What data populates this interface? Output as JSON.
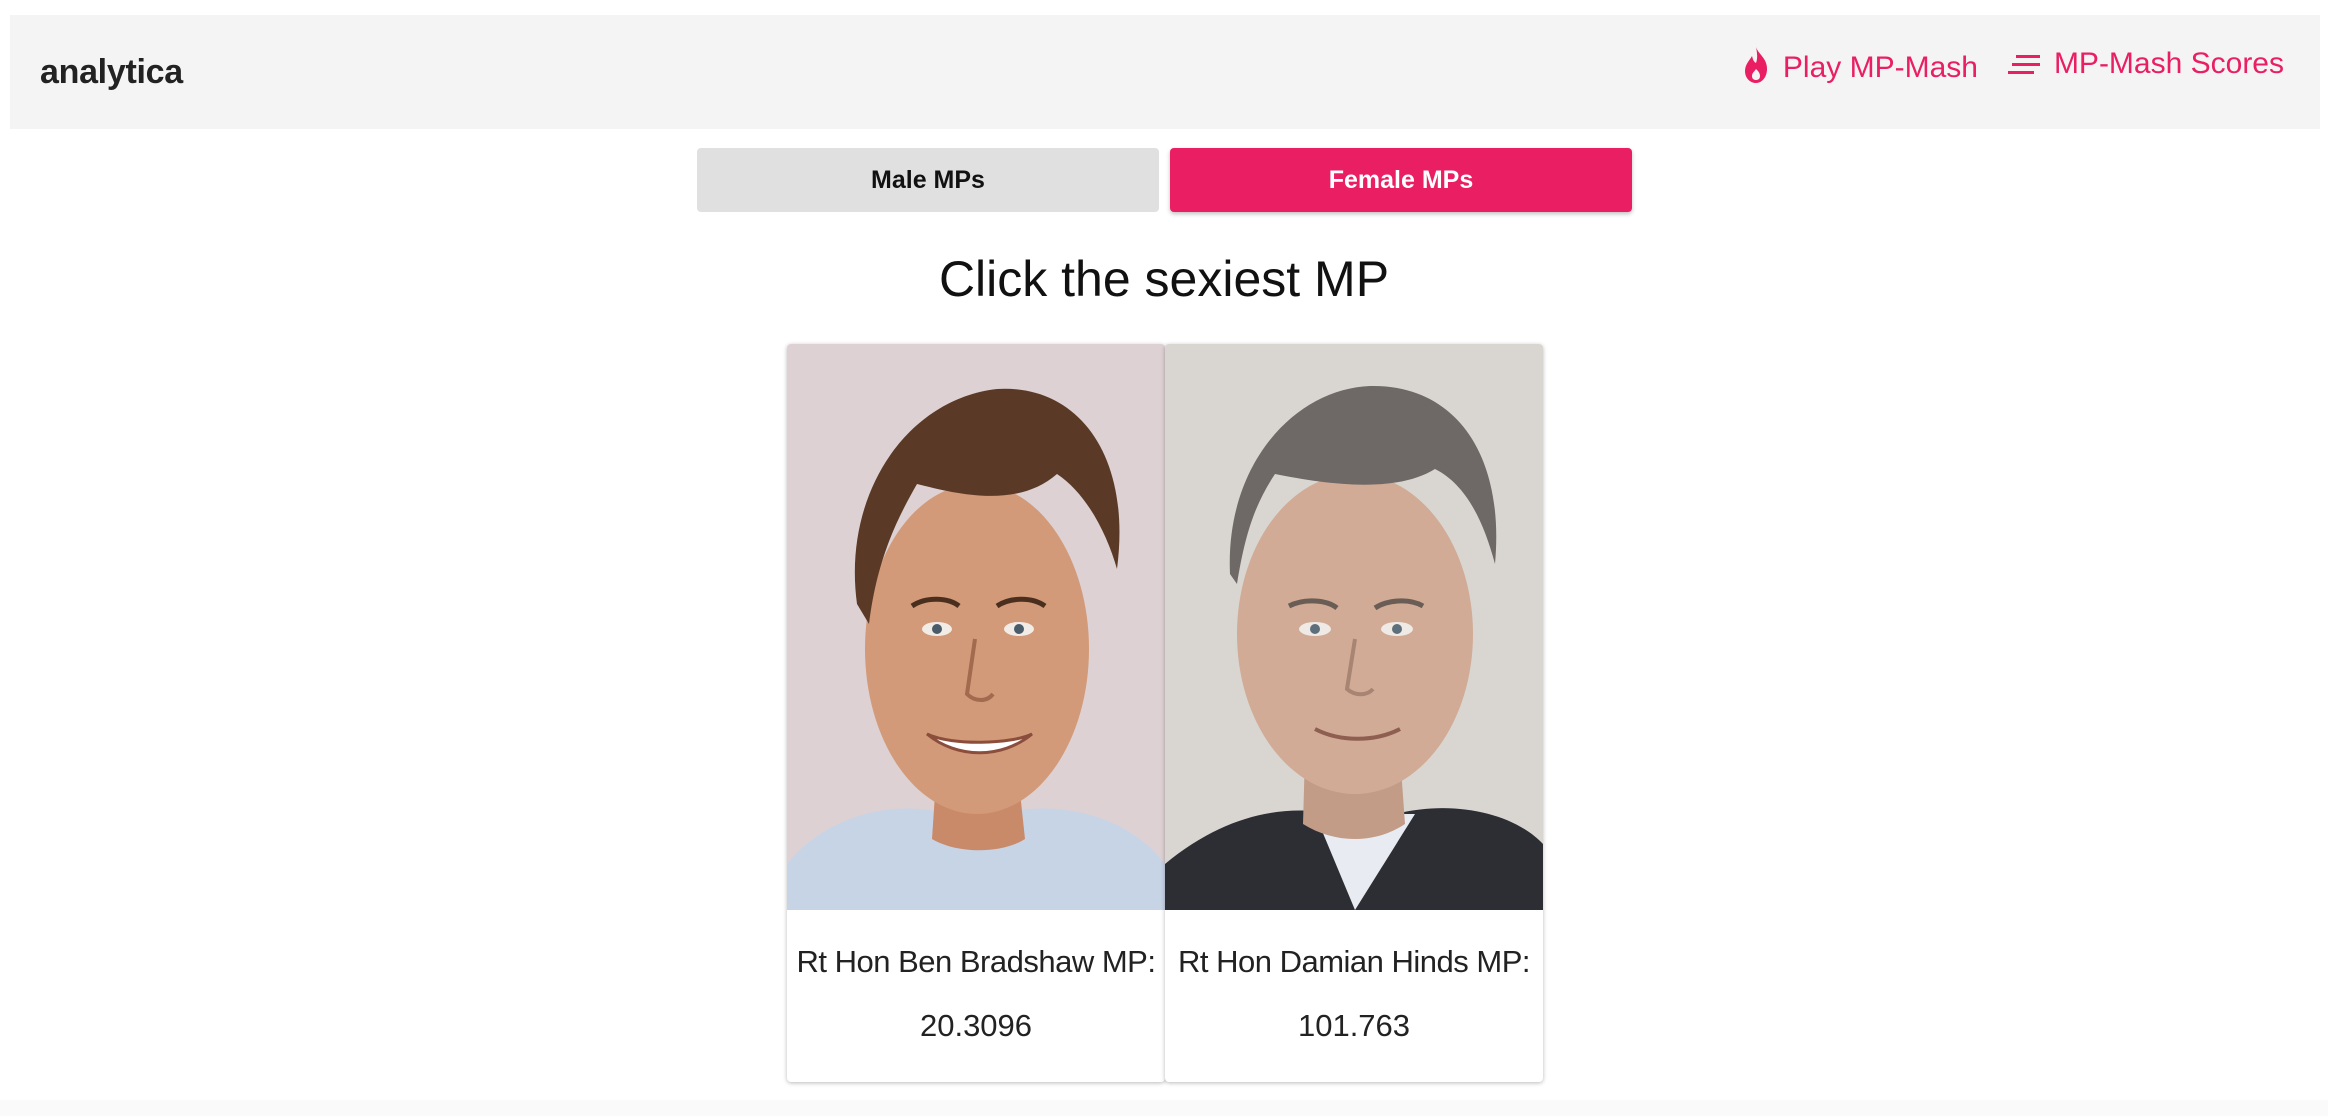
{
  "app": {
    "brand": "analytica"
  },
  "nav": {
    "items": [
      {
        "label": "Play MP-Mash",
        "icon": "flame-icon"
      },
      {
        "label": "MP-Mash Scores",
        "icon": "sort-lines-icon"
      }
    ]
  },
  "toggle": {
    "male_label": "Male MPs",
    "female_label": "Female MPs",
    "selected": "Female MPs"
  },
  "heading": "Click the sexiest MP",
  "cards": [
    {
      "name": "Rt Hon Ben Bradshaw MP:",
      "score": "20.3096"
    },
    {
      "name": "Rt Hon Damian Hinds MP:",
      "score": "101.763"
    }
  ],
  "colors": {
    "accent": "#e91e63",
    "navbar_bg": "#f4f4f4",
    "inactive_button": "#e0e0e0"
  }
}
